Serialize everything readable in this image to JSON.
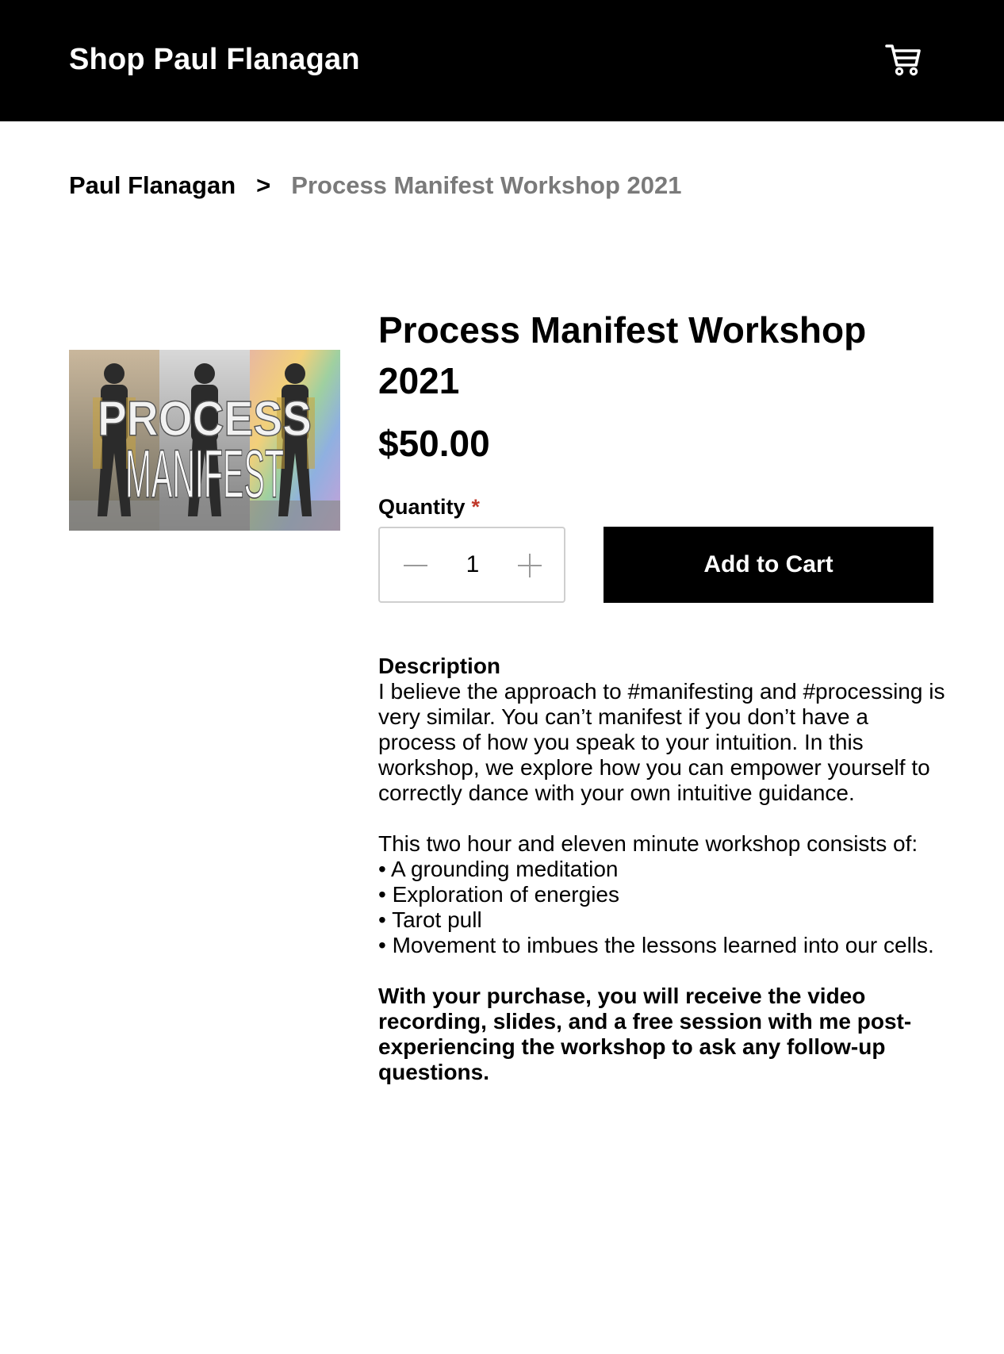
{
  "header": {
    "shop_title": "Shop Paul Flanagan",
    "cart_icon": "shopping-cart-icon"
  },
  "breadcrumb": {
    "home": "Paul Flanagan",
    "separator": ">",
    "current": "Process Manifest Workshop 2021"
  },
  "product": {
    "image_text_top": "PROCESS",
    "image_text_bottom": "MANIFEST",
    "title": "Process Manifest Workshop 2021",
    "price": "$50.00",
    "quantity_label": "Quantity",
    "required_mark": "*",
    "quantity_value": "1",
    "add_to_cart": "Add to Cart"
  },
  "description": {
    "heading": "Description",
    "paragraph1": "I believe the approach to #manifesting and #processing is very similar. You can’t manifest if you don’t have a process of how you speak to your intuition. In this workshop, we explore how you can empower yourself to correctly dance with your own intuitive guidance.",
    "intro2": "This two hour and eleven minute workshop consists of:",
    "bullets": [
      "• A grounding meditation",
      "• Exploration of energies",
      "• Tarot pull",
      "• Movement to imbues the lessons learned into our cells."
    ],
    "closing": "With your purchase, you will receive the video recording, slides, and a free session with me post-experiencing the workshop to ask any follow-up questions."
  },
  "colors": {
    "header_bg": "#000000",
    "breadcrumb_current": "#7a7a7a",
    "required": "#c0392b",
    "button_bg": "#000000"
  }
}
